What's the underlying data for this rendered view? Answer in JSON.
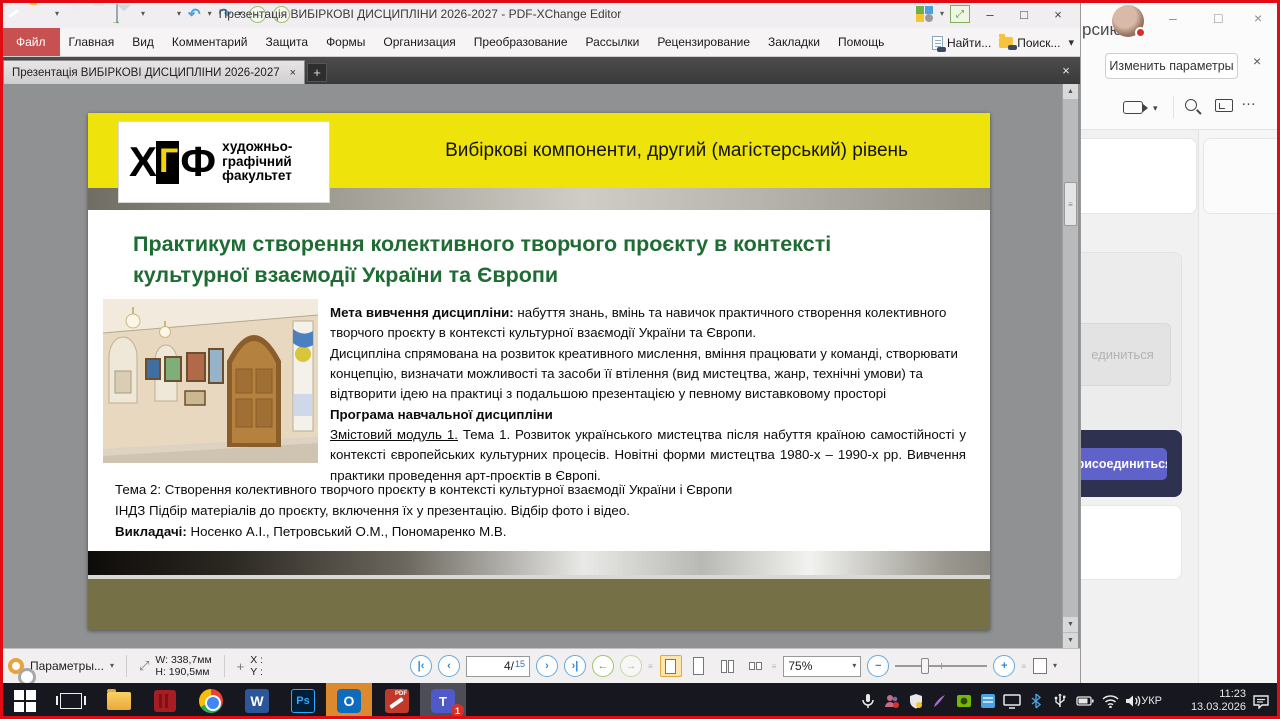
{
  "app": {
    "title": "Презентація ВИБІРКОВІ ДИСЦИПЛІНИ 2026-2027 - PDF-XChange Editor",
    "menu": {
      "file": "Файл",
      "home": "Главная",
      "view": "Вид",
      "comment": "Комментарий",
      "protection": "Защита",
      "forms": "Формы",
      "organize": "Организация",
      "convert": "Преобразование",
      "mailings": "Рассылки",
      "review": "Рецензирование",
      "bookmarks": "Закладки",
      "help": "Помощь"
    },
    "find_label": "Найти...",
    "search_label": "Поиск...",
    "tab_title": "Презентація ВИБІРКОВІ ДИСЦИПЛІНИ 2026-2027"
  },
  "slide": {
    "logo": {
      "l1": "Х",
      "l2": "Г",
      "l3": "Ф",
      "t1": "художньо-",
      "t2": "графічний",
      "t3": "факультет"
    },
    "banner": "Вибіркові компоненти, другий (магістерський) рівень",
    "title": "Практикум створення колективного творчого проєкту в контексті культурної взаємодії України та Європи",
    "meta_label": "Мета вивчення дисципліни:",
    "meta_text": " набуття знань, вмінь та навичок практичного створення колективного творчого проєкту в контексті культурної взаємодії України та Європи.",
    "p2": "Дисципліна спрямована на розвиток креативного мислення, вміння працювати у команді, створювати концепцію, визначати можливості та засоби її втілення (вид мистецтва, жанр, технічні умови) та відтворити ідею на практиці з подальшою презентацією у певному виставковому просторі",
    "program_label": "Програма навчальної дисципліни",
    "module_label": "Змістовий модуль 1.",
    "module_text": " Тема 1. Розвиток українського мистецтва після набуття країною самостійності у контексті європейських культурних процесів. Новітні форми мистецтва 1980-х – 1990-х рр. Вивчення практики проведення арт-проєктів в Європі.",
    "theme2": "Тема 2: Створення колективного творчого проєкту в контексті культурної взаємодії України і Європи",
    "indz": "ІНДЗ Підбір матеріалів до проєкту, включення їх у презентацію. Відбір фото і відео.",
    "teachers_label": "Викладачі:",
    "teachers_text": "  Носенко А.І., Петровський О.М., Пономаренко М.В."
  },
  "statusbar": {
    "options_label": "Параметры...",
    "width_label": "W: 338,7мм",
    "height_label": "H: 190,5мм",
    "x_label": "X :",
    "y_label": "Y :",
    "page_current": "4/",
    "page_total": "15",
    "zoom_value": "75%"
  },
  "panel": {
    "clipped_title": "рсию",
    "change_params_label": "Изменить параметры",
    "join_disabled_label": "единиться",
    "join_label": "Присоединиться"
  },
  "taskbar": {
    "lang": "УКР",
    "time": "11:23",
    "date": "13.03.2026",
    "teams_badge": "1"
  },
  "icons": {
    "word_letter": "W",
    "photoshop_letter": "Ps",
    "outlook_letter": "O",
    "teams_letter": "T",
    "pdf_label": "PDF"
  },
  "glyphs": {
    "caret_down": "▾",
    "close": "×",
    "minimize": "–",
    "maximize": "□",
    "plus": "+",
    "up": "▲",
    "down": "▼",
    "first": "|‹",
    "prev": "‹",
    "next": "›",
    "last": "›|",
    "back": "←",
    "forward": "→",
    "undo": "↶",
    "redo": "↷",
    "minus": "−",
    "more": "…",
    "grip": "≡",
    "expand": "⤢"
  },
  "colors": {
    "accent_red": "#c75050",
    "slide_yellow": "#efe30c",
    "slide_green": "#1e6b33",
    "slide_olive": "#767047",
    "join_blue": "#5f63c9",
    "outlook_orange": "#dd8a2f"
  }
}
